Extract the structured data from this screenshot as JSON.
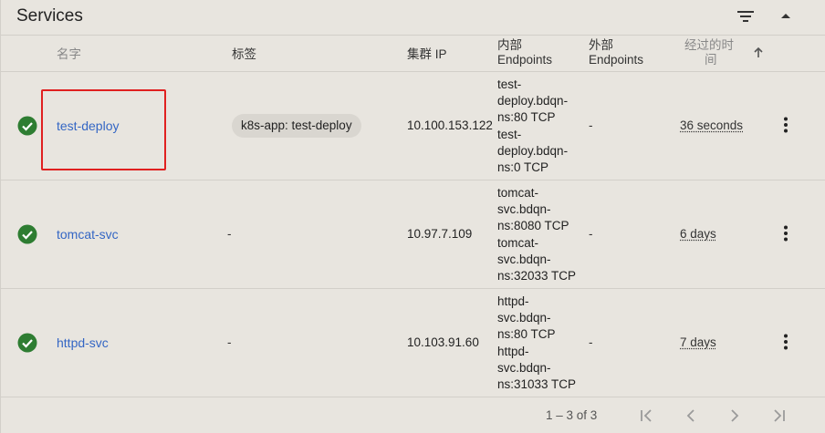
{
  "panel": {
    "title": "Services",
    "filter_icon": "filter-list-icon",
    "collapse_icon": "arrow-drop-up-icon"
  },
  "columns": {
    "name": "名字",
    "labels": "标签",
    "cluster_ip": "集群 IP",
    "internal_line1": "内部",
    "internal_line2": "Endpoints",
    "external_line1": "外部",
    "external_line2": "Endpoints",
    "age_line1": "经过的时",
    "age_line2": "间",
    "sort_icon": "arrow-upward-icon"
  },
  "rows": [
    {
      "status": "check-circle-icon",
      "name": "test-deploy",
      "label": "k8s-app: test-deploy",
      "cluster_ip": "10.100.153.122",
      "internal": [
        "test-deploy.bdqn-ns:80 TCP",
        "test-deploy.bdqn-ns:0 TCP"
      ],
      "internal_lines": [
        [
          "test-",
          "deploy.bdqn-",
          "ns:80 TCP"
        ],
        [
          "test-",
          "deploy.bdqn-",
          "ns:0 TCP"
        ]
      ],
      "external": "-",
      "age": "36 seconds"
    },
    {
      "status": "check-circle-icon",
      "name": "tomcat-svc",
      "label": "-",
      "cluster_ip": "10.97.7.109",
      "internal_lines": [
        [
          "tomcat-",
          "svc.bdqn-",
          "ns:8080 TCP"
        ],
        [
          "tomcat-",
          "svc.bdqn-",
          "ns:32033 TCP"
        ]
      ],
      "external": "-",
      "age": "6 days"
    },
    {
      "status": "check-circle-icon",
      "name": "httpd-svc",
      "label": "-",
      "cluster_ip": "10.103.91.60",
      "internal_lines": [
        [
          "httpd-",
          "svc.bdqn-",
          "ns:80 TCP"
        ],
        [
          "httpd-",
          "svc.bdqn-",
          "ns:31033 TCP"
        ]
      ],
      "external": "-",
      "age": "7 days"
    }
  ],
  "pagination": {
    "range": "1 – 3 of 3",
    "first_icon": "first-page-icon",
    "prev_icon": "chevron-left-icon",
    "next_icon": "chevron-right-icon",
    "last_icon": "last-page-icon"
  },
  "colors": {
    "link": "#3466c4",
    "success": "#2e7d32",
    "highlight": "#e02020"
  }
}
